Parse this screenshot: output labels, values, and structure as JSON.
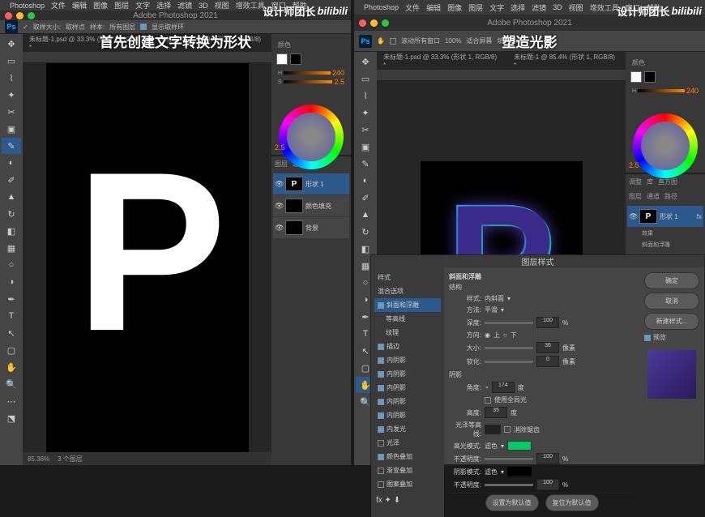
{
  "menu": [
    "Photoshop",
    "文件",
    "编辑",
    "图像",
    "图层",
    "文字",
    "选择",
    "滤镜",
    "3D",
    "视图",
    "增效工具",
    "窗口",
    "帮助"
  ],
  "title": "Adobe Photoshop 2021",
  "watermark": "设计师团长",
  "bilibili": "bilibili",
  "left": {
    "overlay": "首先创建文字转换为形状",
    "tab": "未标题-1.psd @ 33.3% (形状 1, RGB/8) *",
    "tab2": "未标题-1 @ 85.4% (形状 1, RGB/8) *",
    "optbar": {
      "sample": "取样大小:",
      "point": "取样点",
      "sample2": "样本:",
      "all": "所有图层",
      "show": "显示取样环"
    },
    "panels": {
      "color": "颜色",
      "adj": "调整",
      "lib": "库",
      "layers": "图层",
      "channels": "通道",
      "paths": "路径"
    },
    "color_vals": {
      "h": "240",
      "s": "2.5",
      "b": "2.5"
    },
    "layers": [
      {
        "name": "形状 1",
        "sel": true,
        "thumb": "P"
      },
      {
        "name": "颜色填充",
        "sel": false,
        "thumb": ""
      },
      {
        "name": "背景",
        "sel": false,
        "thumb": ""
      }
    ],
    "zoom": "85.36%",
    "doc": "3 个图层"
  },
  "right": {
    "overlay": "塑造光影",
    "optbar": {
      "scroll": "滚动所有窗口",
      "pct": "100%",
      "fit": "适合屏幕",
      "fill": "填充屏幕"
    },
    "layers": [
      {
        "name": "形状 1",
        "sel": true,
        "thumb": "P",
        "fx": "fx"
      }
    ],
    "fx_label": "效果",
    "fx_sub": "斜面和浮雕",
    "zoom": "85.36%"
  },
  "dialog": {
    "title": "图层样式",
    "left_title": "样式",
    "blend": "混合选项",
    "fx": [
      {
        "label": "斜面和浮雕",
        "on": true,
        "sel": true
      },
      {
        "label": "等高线",
        "on": false
      },
      {
        "label": "纹理",
        "on": false
      },
      {
        "label": "描边",
        "on": true
      },
      {
        "label": "内阴影",
        "on": true
      },
      {
        "label": "内阴影",
        "on": true
      },
      {
        "label": "内阴影",
        "on": true
      },
      {
        "label": "内阴影",
        "on": true
      },
      {
        "label": "内阴影",
        "on": true
      },
      {
        "label": "内发光",
        "on": true
      },
      {
        "label": "光泽",
        "on": false
      },
      {
        "label": "颜色叠加",
        "on": true
      },
      {
        "label": "渐变叠加",
        "on": false
      },
      {
        "label": "图案叠加",
        "on": false
      }
    ],
    "section": "斜面和浮雕",
    "struct": "结构",
    "style_l": "样式:",
    "style_v": "内斜面",
    "method_l": "方法:",
    "method_v": "平滑",
    "depth_l": "深度:",
    "depth_v": "100",
    "pct": "%",
    "dir_l": "方向:",
    "up": "上",
    "down": "下",
    "size_l": "大小:",
    "size_v": "36",
    "px": "像素",
    "soft_l": "软化:",
    "soft_v": "0",
    "shade": "阴影",
    "angle_l": "角度:",
    "angle_v": "174",
    "deg": "度",
    "global": "使用全局光",
    "alt_l": "高度:",
    "alt_v": "35",
    "gloss_l": "光泽等高线:",
    "anti": "消除锯齿",
    "hi_mode": "高光模式:",
    "screen": "滤色",
    "opacity": "不透明度:",
    "op1": "100",
    "sh_mode": "阴影模式:",
    "mult": "滤色",
    "op2": "100",
    "btn_ok": "确定",
    "btn_cancel": "取消",
    "btn_new": "新建样式...",
    "preview": "预览",
    "set_def": "设置为默认值",
    "reset_def": "复位为默认值"
  }
}
